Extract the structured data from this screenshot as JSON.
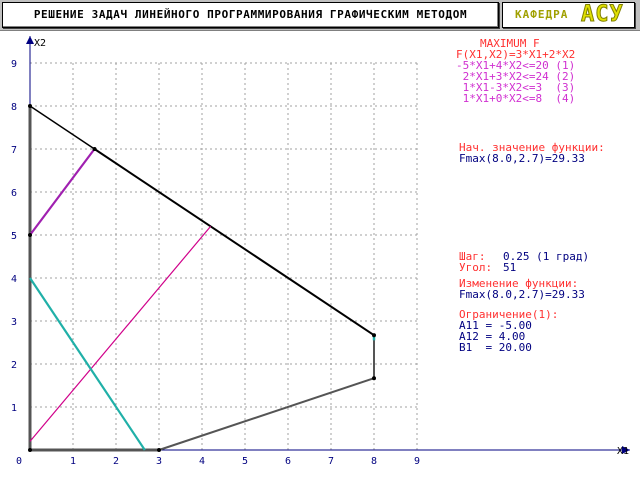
{
  "header": {
    "title": "РЕШЕНИЕ ЗАДАЧ ЛИНЕЙНОГО ПРОГРАММИРОВАНИЯ ГРАФИЧЕСКИМ МЕТОДОМ",
    "dept_label": "КАФЕДРА",
    "dept_name": "АСУ"
  },
  "colors": {
    "boundary": "#555555",
    "feasible_top": "#000000",
    "constraint1": "#d0008a",
    "constraint2": "#20b0a8",
    "constraint3": "#a020b0",
    "grid": "#a0a0a0",
    "axes": "#000080"
  },
  "problem": {
    "heading": "MAXIMUM F",
    "objective": "F(X1,X2)=3*X1+2*X2",
    "constraints": [
      "-5*X1+4*X2<=20 (1)",
      " 2*X1+3*X2<=24 (2)",
      " 1*X1-3*X2<=3  (3)",
      " 1*X1+0*X2<=8  (4)"
    ]
  },
  "initial": {
    "label": "Нач. значение функции:",
    "value": "Fmax(8.0,2.7)=29.33"
  },
  "step": {
    "step_label": "Шаг:",
    "step_value": "0.25 (1 град)",
    "angle_label": "Угол:",
    "angle_value": "51"
  },
  "change": {
    "label": "Изменение функции:",
    "value": "Fmax(8.0,2.7)=29.33"
  },
  "constraint_info": {
    "label": "Ограничение(1):",
    "lines": [
      "A11 = -5.00",
      "A12 = 4.00",
      "B1  = 20.00"
    ]
  },
  "chart_data": {
    "type": "line",
    "xlabel": "X1",
    "ylabel": "X2",
    "xlim": [
      0,
      9
    ],
    "ylim": [
      0,
      9
    ],
    "xticks": [
      "0",
      "1",
      "2",
      "3",
      "4",
      "5",
      "6",
      "7",
      "8",
      "9"
    ],
    "yticks": [
      "1",
      "2",
      "3",
      "4",
      "5",
      "6",
      "7",
      "8",
      "9"
    ],
    "grid": true,
    "series": [
      {
        "role": "feasible-region-boundary",
        "x": [
          0,
          3,
          8,
          8,
          1.5,
          0,
          0
        ],
        "y": [
          0,
          0,
          1.67,
          2.67,
          7,
          8,
          0
        ]
      },
      {
        "role": "constraint-1",
        "x": [
          0,
          4.2
        ],
        "y": [
          0.2,
          5.2
        ]
      },
      {
        "role": "constraint-2",
        "x": [
          0,
          2.67
        ],
        "y": [
          4,
          0
        ]
      },
      {
        "role": "constraint-3",
        "x": [
          0,
          1.5
        ],
        "y": [
          5,
          7
        ]
      },
      {
        "role": "constraint-4-edge",
        "x": [
          8,
          8
        ],
        "y": [
          2.55,
          2.67
        ]
      }
    ],
    "vertices": [
      {
        "x": 0,
        "y": 0
      },
      {
        "x": 3,
        "y": 0
      },
      {
        "x": 8,
        "y": 1.67
      },
      {
        "x": 8,
        "y": 2.67
      },
      {
        "x": 1.5,
        "y": 7
      },
      {
        "x": 0,
        "y": 8
      },
      {
        "x": 0,
        "y": 5
      }
    ]
  }
}
